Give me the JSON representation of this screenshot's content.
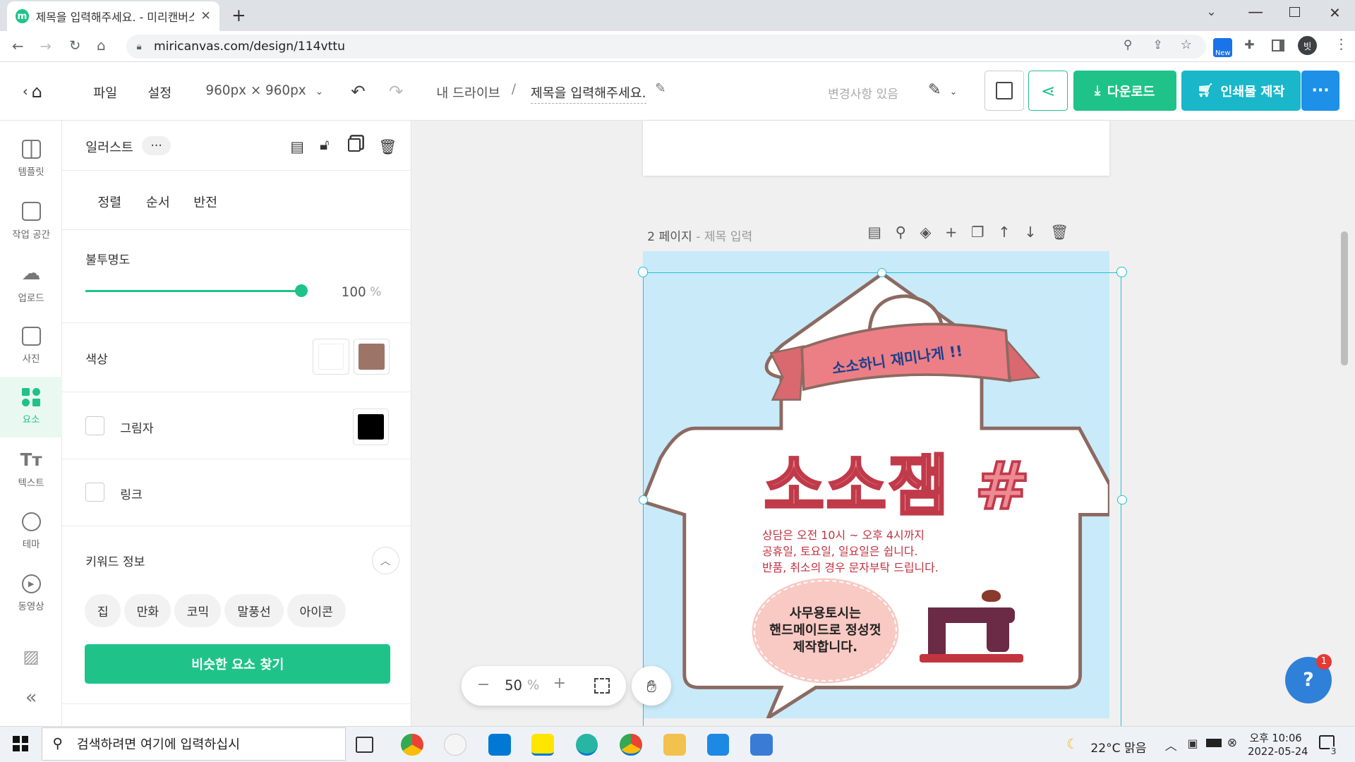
{
  "browser": {
    "tab_title": "제목을 입력해주세요. - 미리캔버스",
    "url": "miricanvas.com/design/114vttu",
    "profile_initial": "빗"
  },
  "header": {
    "file_menu": "파일",
    "settings_menu": "설정",
    "canvas_size": "960px × 960px",
    "breadcrumb_drive": "내 드라이브",
    "breadcrumb_sep": "/",
    "design_title": "제목을 입력해주세요.",
    "save_status": "변경사항 있음",
    "download_label": "다운로드",
    "print_label": "인쇄물 제작",
    "more_label": "···"
  },
  "rail": {
    "items": [
      {
        "label": "템플릿",
        "icon": "template-icon"
      },
      {
        "label": "작업 공간",
        "icon": "workspace-icon"
      },
      {
        "label": "업로드",
        "icon": "upload-icon"
      },
      {
        "label": "사진",
        "icon": "photo-icon"
      },
      {
        "label": "요소",
        "icon": "elements-icon"
      },
      {
        "label": "텍스트",
        "icon": "text-icon"
      },
      {
        "label": "테마",
        "icon": "theme-icon"
      },
      {
        "label": "동영상",
        "icon": "video-icon"
      }
    ],
    "collapse": "«"
  },
  "panel": {
    "title": "일러스트",
    "menu_dots": "···",
    "tabs": [
      "정렬",
      "순서",
      "반전"
    ],
    "opacity_label": "불투명도",
    "opacity_value": "100",
    "opacity_unit": "%",
    "opacity_fraction": 1.0,
    "color_label": "색상",
    "color_swatches": [
      "#ffffff",
      "#9c7468"
    ],
    "shadow_label": "그림자",
    "shadow_color": "#000000",
    "link_label": "링크",
    "keyword_label": "키워드 정보",
    "keywords": [
      "집",
      "만화",
      "코믹",
      "말풍선",
      "아이콘"
    ],
    "similar_button": "비슷한 요소 찾기"
  },
  "page": {
    "page_label": "2 페이지",
    "page_title_placeholder": "- 제목 입력",
    "banner_text": "소소하니 재미나게 !!",
    "big_title": "소소잼 #",
    "info_lines": [
      "상담은 오전 10시 ~ 오후 4시까지",
      "공휴일, 토요일, 일요일은 쉽니다.",
      "반품, 취소의 경우 문자부탁 드립니다."
    ],
    "bubble_lines": [
      "사무용토시는",
      "핸드메이드로 정성껏",
      "제작합니다."
    ]
  },
  "zoom": {
    "minus": "−",
    "value": "50",
    "unit": "%",
    "plus": "+"
  },
  "help_badge": "1",
  "taskbar": {
    "search_placeholder": "검색하려면 여기에 입력하십시",
    "weather": "22°C 맑음",
    "time": "오후 10:06",
    "date": "2022-05-24",
    "notif_count": "3"
  },
  "colors": {
    "accent_green": "#1fc38a",
    "print_teal": "#19b7c9",
    "more_blue": "#1e90e8",
    "canvas_bg": "#c9eaf8",
    "house_stroke": "#8b6a62",
    "title_pink": "#ee8a94",
    "info_red": "#c23040"
  }
}
